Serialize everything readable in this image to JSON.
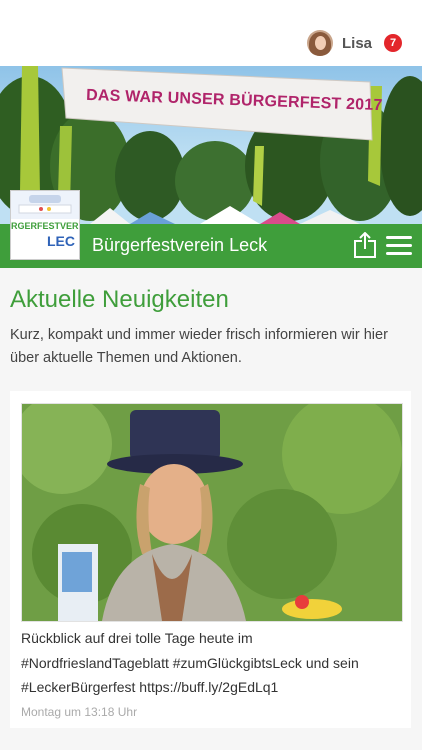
{
  "user": {
    "name": "Lisa",
    "notification_count": "7"
  },
  "banner": {
    "headline": "DAS WAR UNSER BÜRGERFEST 2017"
  },
  "header": {
    "club_name": "Bürgerfestverein Leck",
    "logo_text_top": "RGERFESTVEREI",
    "logo_text_bottom": "LEC"
  },
  "main": {
    "title": "Aktuelle Neuigkeiten",
    "intro": "Kurz, kompakt und immer wieder frisch informieren wir hier über aktuelle Themen und Aktionen."
  },
  "post": {
    "text": "Rückblick auf drei tolle Tage heute im #NordfrieslandTageblatt #zumGlückgibtsLeck und sein #LeckerBürgerfest https://buff.ly/2gEdLq1",
    "timestamp": "Montag um 13:18 Uhr"
  },
  "colors": {
    "accent": "#3f9e3b",
    "badge": "#e3262b"
  },
  "icons": [
    "avatar",
    "share-icon",
    "menu-icon"
  ]
}
